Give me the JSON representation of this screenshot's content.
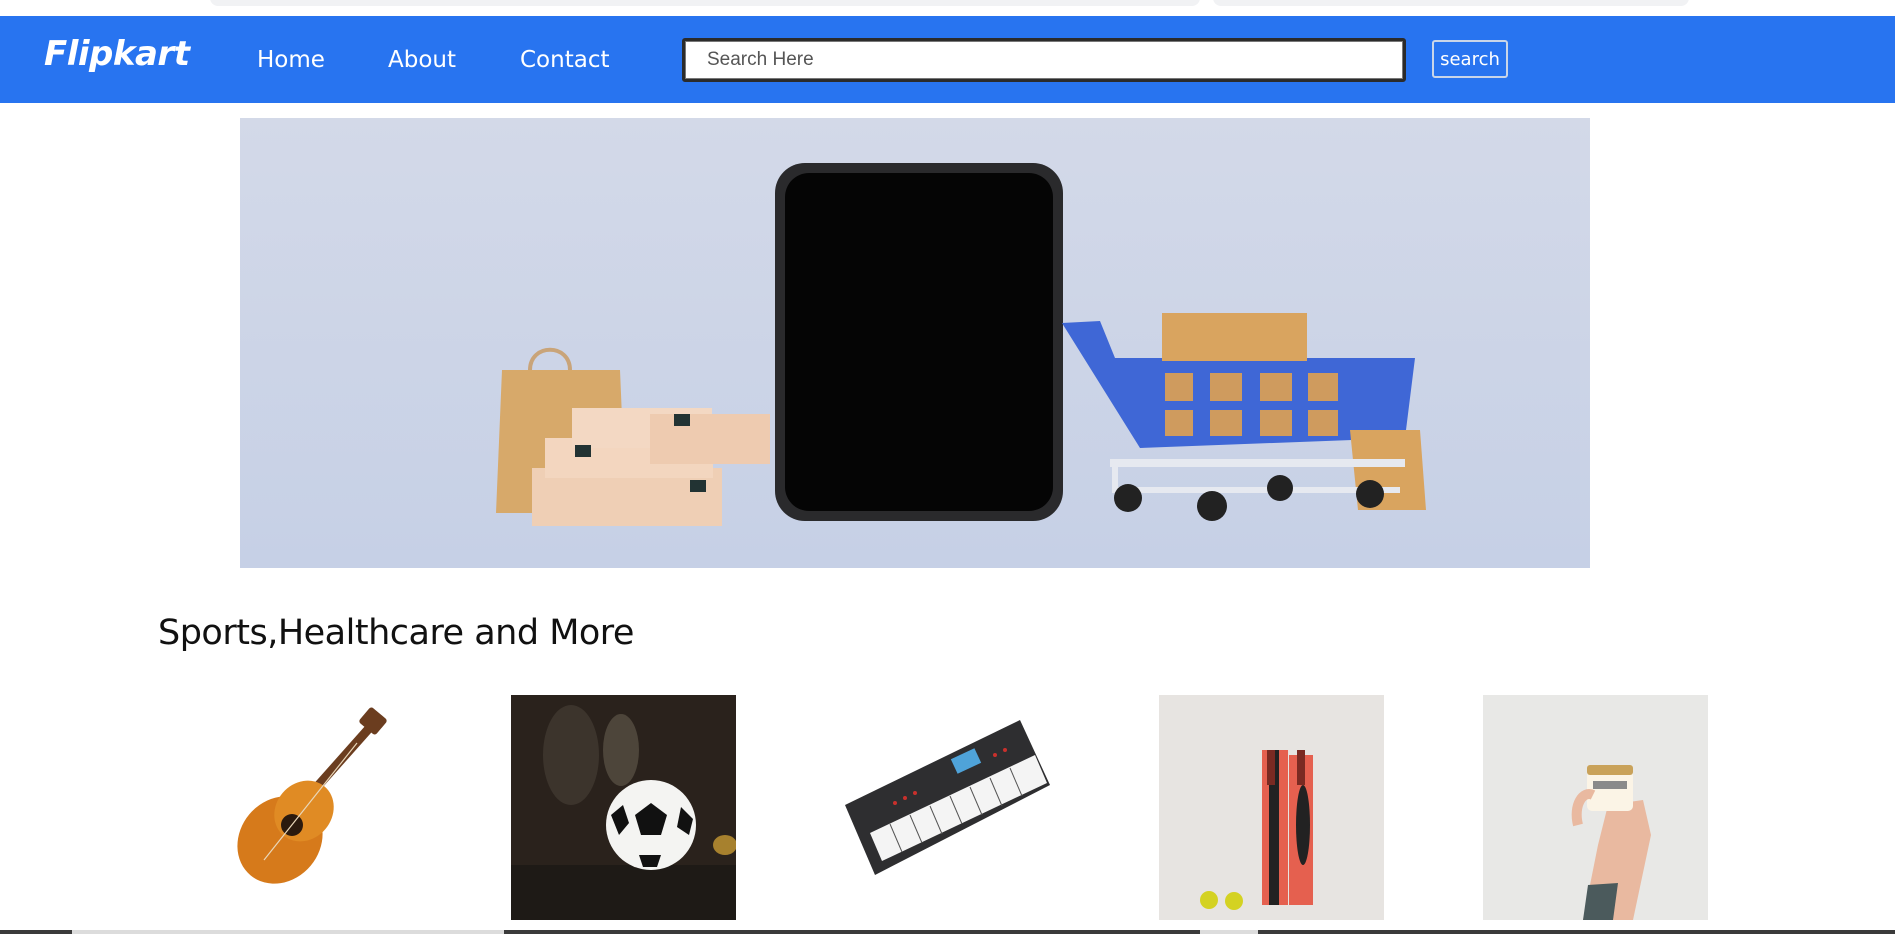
{
  "navbar": {
    "brand": "Flipkart",
    "links": [
      {
        "label": "Home"
      },
      {
        "label": "About"
      },
      {
        "label": "Contact"
      }
    ],
    "search": {
      "placeholder": "Search Here",
      "value": "",
      "button_label": "search"
    }
  },
  "hero": {
    "image": "shopping-banner-phone-cart-bags"
  },
  "section": {
    "title": "Sports,Healthcare and More"
  },
  "products": [
    {
      "image": "acoustic-guitar"
    },
    {
      "image": "soccer-ball"
    },
    {
      "image": "keyboard-synthesizer"
    },
    {
      "image": "cricket-bats"
    },
    {
      "image": "cream-jar-hand"
    }
  ],
  "colors": {
    "navbar": "#2874f0",
    "text": "#111111",
    "background": "#ffffff"
  }
}
